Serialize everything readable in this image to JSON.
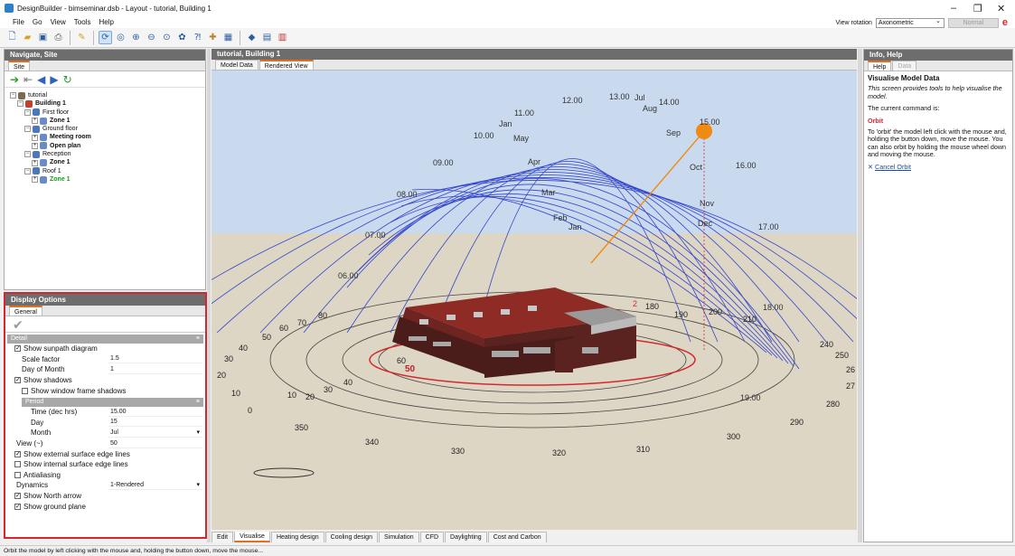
{
  "window": {
    "title": "DesignBuilder - bimseminar.dsb - Layout - tutorial, Building 1",
    "controls": [
      "–",
      "❐",
      "✕"
    ]
  },
  "menu": [
    "File",
    "Go",
    "View",
    "Tools",
    "Help"
  ],
  "view_rotation": {
    "label": "View rotation",
    "value": "Axonometric",
    "mode_button": "Normal"
  },
  "toolbar_icons": [
    "new-file-icon",
    "open-folder-icon",
    "save-icon",
    "print-icon",
    "wizard-icon",
    "orbit-icon",
    "zoom-icon",
    "zoom-extents-icon",
    "pan-icon",
    "zoom-window-icon",
    "walk-icon",
    "info-icon",
    "component-icon",
    "image-icon",
    "render-icon",
    "grid-icon",
    "options-icon"
  ],
  "navigate": {
    "header": "Navigate, Site",
    "tab": "Site",
    "tree": [
      {
        "label": "tutorial",
        "level": 0,
        "bold": false
      },
      {
        "label": "Building 1",
        "level": 1,
        "bold": true
      },
      {
        "label": "First floor",
        "level": 2,
        "bold": false
      },
      {
        "label": "Zone 1",
        "level": 3,
        "bold": true
      },
      {
        "label": "Ground floor",
        "level": 2,
        "bold": false
      },
      {
        "label": "Meeting room",
        "level": 3,
        "bold": true
      },
      {
        "label": "Open plan",
        "level": 3,
        "bold": true
      },
      {
        "label": "Reception",
        "level": 2,
        "bold": false
      },
      {
        "label": "Zone 1",
        "level": 3,
        "bold": true
      },
      {
        "label": "Roof 1",
        "level": 2,
        "bold": false
      },
      {
        "label": "Zone 1",
        "level": 3,
        "bold": true,
        "green": true
      }
    ]
  },
  "display_options": {
    "header": "Display Options",
    "tab": "General",
    "section_detail": "Detail",
    "section_period": "Period",
    "show_sunpath": "Show sunpath diagram",
    "scale_factor_label": "Scale factor",
    "scale_factor_value": "1.5",
    "day_of_month_label": "Day of Month",
    "day_of_month_value": "1",
    "show_shadows": "Show shadows",
    "show_window_frame_shadows": "Show window frame shadows",
    "time_label": "Time (dec hrs)",
    "time_value": "15.00",
    "day_label": "Day",
    "day_value": "15",
    "month_label": "Month",
    "month_value": "Jul",
    "view_label": "View (~)",
    "view_value": "50",
    "show_ext_edges": "Show external surface edge lines",
    "show_int_edges": "Show internal surface edge lines",
    "antialiasing": "Antialiasing",
    "dynamics_label": "Dynamics",
    "dynamics_value": "1-Rendered",
    "show_north_arrow": "Show North arrow",
    "show_ground_plane": "Show ground plane"
  },
  "main": {
    "header": "tutorial, Building 1",
    "tabs": [
      "Model Data",
      "Rendered View"
    ],
    "bottom_tabs": [
      "Edit",
      "Visualise",
      "Heating design",
      "Cooling design",
      "Simulation",
      "CFD",
      "Daylighting",
      "Cost and Carbon"
    ]
  },
  "scene": {
    "colors": {
      "sky": "#c9daef",
      "ground": "#ddd6c4",
      "sunpath": "#3344cc",
      "sun": "#f08a10",
      "roof": "#8e2b25",
      "wall": "#5a2320"
    },
    "hour_labels": [
      "06.00",
      "07.00",
      "08.00",
      "09.00",
      "10.00",
      "11.00",
      "12.00",
      "13.00",
      "14.00",
      "15.00",
      "16.00",
      "17.00",
      "18.00",
      "19.00"
    ],
    "month_labels": [
      "Jan",
      "May",
      "Apr",
      "Mar",
      "Feb",
      "Jan",
      "Jul",
      "Aug",
      "Sep",
      "Oct",
      "Nov",
      "Dec"
    ],
    "azimuth_labels": [
      "0",
      "10",
      "20",
      "30",
      "40",
      "50",
      "60",
      "70",
      "80",
      "180",
      "190",
      "200",
      "210",
      "240",
      "250",
      "26",
      "27",
      "280",
      "290",
      "300",
      "310",
      "320",
      "330",
      "340",
      "350",
      "10",
      "20",
      "30",
      "40",
      "60"
    ],
    "shadow_label": "50",
    "sun_label": "2"
  },
  "info": {
    "header": "Info, Help",
    "tabs": [
      "Help",
      "Data"
    ],
    "title": "Visualise Model Data",
    "intro": "This screen provides tools to help visualise the model.",
    "current": "The current command is:",
    "command": "Orbit",
    "description": "To 'orbit' the model left click with the mouse and, holding the button down, move the mouse. You can also orbit by holding the mouse wheel down and moving the mouse.",
    "cancel": "Cancel Orbit"
  },
  "status": "Orbit the model by left clicking with the mouse and, holding the button down, move the mouse..."
}
